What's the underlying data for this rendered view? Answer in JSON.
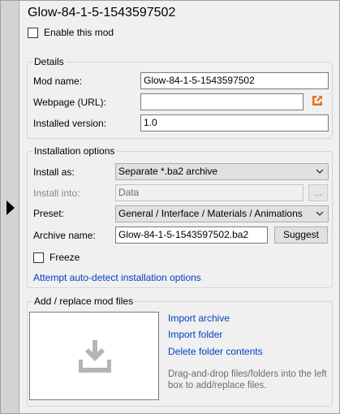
{
  "mod": {
    "title": "Glow-84-1-5-1543597502",
    "enable_label": "Enable this mod"
  },
  "details": {
    "group_title": "Details",
    "mod_name_label": "Mod name:",
    "mod_name_value": "Glow-84-1-5-1543597502",
    "webpage_label": "Webpage (URL):",
    "webpage_value": "",
    "installed_version_label": "Installed version:",
    "installed_version_value": "1.0"
  },
  "installation": {
    "group_title": "Installation options",
    "install_as_label": "Install as:",
    "install_as_value": "Separate *.ba2 archive",
    "install_into_label": "Install into:",
    "install_into_value": "Data",
    "browse_label": "...",
    "preset_label": "Preset:",
    "preset_value": "General / Interface / Materials / Animations",
    "archive_name_label": "Archive name:",
    "archive_name_value": "Glow-84-1-5-1543597502.ba2",
    "suggest_label": "Suggest",
    "freeze_label": "Freeze",
    "auto_detect_link": "Attempt auto-detect installation options"
  },
  "files": {
    "group_title": "Add / replace mod files",
    "import_archive": "Import archive",
    "import_folder": "Import folder",
    "delete_folder_contents": "Delete folder contents",
    "hint": "Drag-and-drop files/folders into the left box to add/replace files."
  },
  "colors": {
    "link": "#0040c0",
    "accent_orange": "#e8731a",
    "drop_icon": "#b5b5b5"
  }
}
